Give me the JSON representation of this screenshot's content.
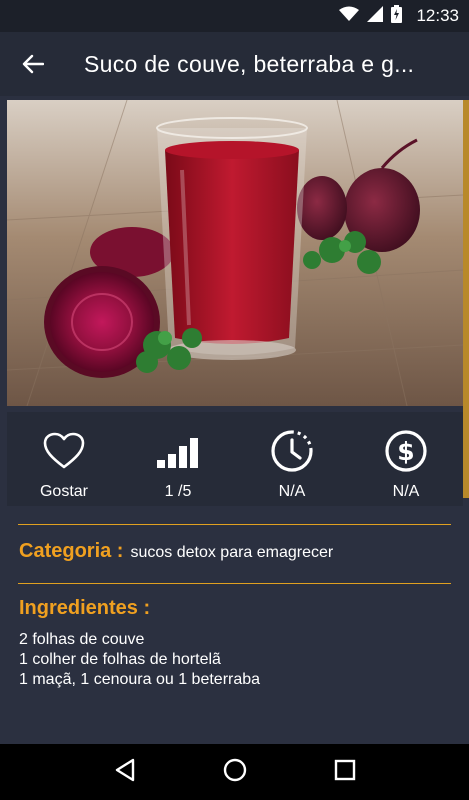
{
  "status_bar": {
    "time": "12:33",
    "icons": [
      "wifi-icon",
      "signal-icon",
      "battery-icon"
    ]
  },
  "app_bar": {
    "title": "Suco de couve, beterraba e g...",
    "back_icon": "arrow-back-icon"
  },
  "hero_image": {
    "subject": "beetroot juice glass"
  },
  "actions": [
    {
      "id": "like",
      "icon": "heart-icon",
      "label": "Gostar"
    },
    {
      "id": "difficulty",
      "icon": "difficulty-bars-icon",
      "label": "1 /5"
    },
    {
      "id": "time",
      "icon": "clock-icon",
      "label": "N/A"
    },
    {
      "id": "cost",
      "icon": "dollar-icon",
      "label": "N/A"
    }
  ],
  "category": {
    "key": "Categoria :",
    "value": "sucos detox para emagrecer"
  },
  "ingredients": {
    "title": "Ingredientes :",
    "items": [
      "2 folhas de couve",
      "1 colher de folhas de hortelã",
      "1 maçã, 1 cenoura ou 1 beterraba"
    ]
  },
  "colors": {
    "accent": "#f0a020",
    "background": "#2b3040",
    "toolbar": "#262b38"
  }
}
